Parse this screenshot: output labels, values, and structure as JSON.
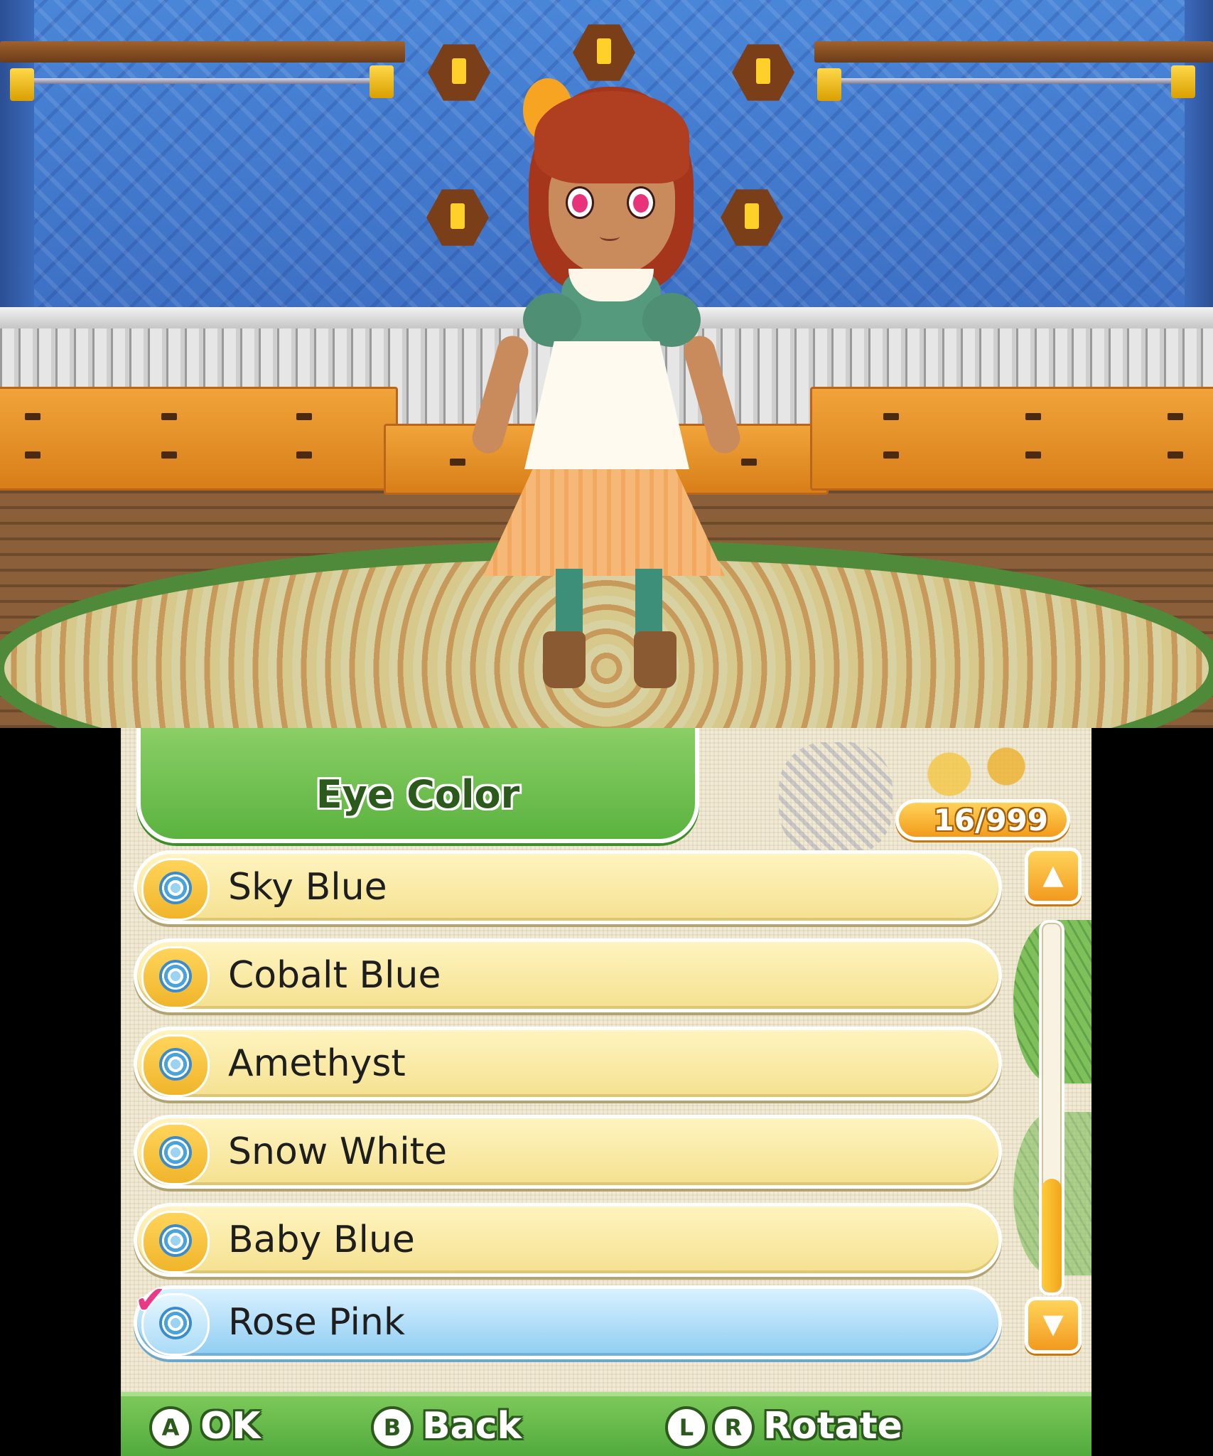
{
  "menu": {
    "title": "Eye Color",
    "counter": "16/999",
    "items": [
      {
        "label": "Sky Blue",
        "selected": false
      },
      {
        "label": "Cobalt Blue",
        "selected": false
      },
      {
        "label": "Amethyst",
        "selected": false
      },
      {
        "label": "Snow White",
        "selected": false
      },
      {
        "label": "Baby Blue",
        "selected": false
      },
      {
        "label": "Rose Pink",
        "selected": true
      }
    ],
    "scroll_up_icon": "▲",
    "scroll_down_icon": "▼"
  },
  "footer": {
    "ok": {
      "button": "A",
      "label": "OK"
    },
    "back": {
      "button": "B",
      "label": "Back"
    },
    "rotate": {
      "buttons": [
        "L",
        "R"
      ],
      "label": "Rotate"
    }
  },
  "colors": {
    "accent_green": "#5bb33f",
    "row_yellow": "#f4e190",
    "selected_blue": "#8fcdf2",
    "eye_color_preview": "#e8337a"
  }
}
